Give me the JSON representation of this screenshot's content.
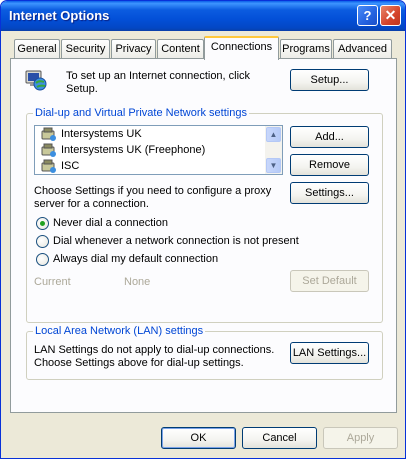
{
  "window": {
    "title": "Internet Options",
    "help_label": "?",
    "close_label": "✕"
  },
  "tabs": [
    {
      "label": "General"
    },
    {
      "label": "Security"
    },
    {
      "label": "Privacy"
    },
    {
      "label": "Content"
    },
    {
      "label": "Connections",
      "active": true
    },
    {
      "label": "Programs"
    },
    {
      "label": "Advanced"
    }
  ],
  "setup": {
    "text_line1": "To set up an Internet connection, click",
    "text_line2": "Setup.",
    "button_label": "Setup..."
  },
  "dialup": {
    "group_label": "Dial-up and Virtual Private Network settings",
    "connections": [
      {
        "name": "Intersystems UK"
      },
      {
        "name": "Intersystems UK (Freephone)"
      },
      {
        "name": "ISC"
      }
    ],
    "add_label": "Add...",
    "remove_label": "Remove",
    "settings_label": "Settings...",
    "proxy_text_line1": "Choose Settings if you need to configure a proxy",
    "proxy_text_line2": "server for a connection.",
    "options": [
      {
        "label": "Never dial a connection",
        "selected": true
      },
      {
        "label": "Dial whenever a network connection is not present",
        "selected": false
      },
      {
        "label": "Always dial my default connection",
        "selected": false
      }
    ],
    "current_label": "Current",
    "current_value": "None",
    "set_default_label": "Set Default"
  },
  "lan": {
    "group_label": "Local Area Network (LAN) settings",
    "text_line1": "LAN Settings do not apply to dial-up connections.",
    "text_line2": "Choose Settings above for dial-up settings.",
    "button_label": "LAN Settings..."
  },
  "footer": {
    "ok_label": "OK",
    "cancel_label": "Cancel",
    "apply_label": "Apply"
  },
  "colors": {
    "titlebar": "#0350D8",
    "dialog_bg": "#ECE9D8",
    "group_label": "#0046D5",
    "radio_dot": "#21A121",
    "active_tab_accent": "#FFC83C"
  }
}
